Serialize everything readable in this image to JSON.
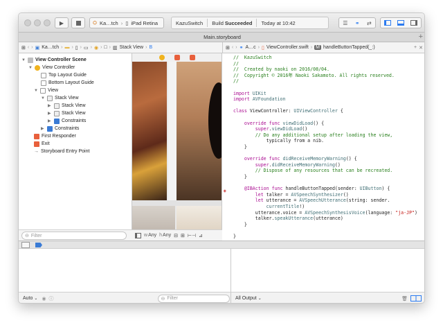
{
  "toolbar": {
    "scheme_app": "Ka…tch",
    "scheme_device": "iPad Retina",
    "status_app": "KazuSwitch",
    "status_build_prefix": "Build",
    "status_build_result": "Succeeded",
    "status_time": "Today at 10:42"
  },
  "tab": {
    "title": "Main.storyboard"
  },
  "navigator": {
    "jumpbar_project": "Ka…tch",
    "jumpbar_item": "Stack View",
    "items": [
      {
        "label": "View Controller Scene",
        "bold": true
      },
      {
        "label": "View Controller"
      },
      {
        "label": "Top Layout Guide"
      },
      {
        "label": "Bottom Layout Guide"
      },
      {
        "label": "View"
      },
      {
        "label": "Stack View"
      },
      {
        "label": "Stack View"
      },
      {
        "label": "Stack View"
      },
      {
        "label": "Constraints"
      },
      {
        "label": "Constraints"
      },
      {
        "label": "First Responder"
      },
      {
        "label": "Exit"
      },
      {
        "label": "Storyboard Entry Point"
      }
    ],
    "filter_placeholder": "Filter"
  },
  "canvas": {
    "size_w_label": "w",
    "size_w_value": "Any",
    "size_h_label": "h",
    "size_h_value": "Any"
  },
  "editor": {
    "jumpbar_auto": "A…c",
    "jumpbar_file": "ViewController.swift",
    "jumpbar_symbol_badge": "M",
    "jumpbar_symbol": "handleButtonTapped(_:)",
    "code": [
      "//  KazuSwitch",
      "//",
      "//  Created by naoki on 2016/08/04.",
      "//  Copyright © 2016年 Naoki Sakamoto. All rights reserved.",
      "//",
      "",
      "import UIKit",
      "import AVFoundation",
      "",
      "class ViewController: UIViewController {",
      "",
      "    override func viewDidLoad() {",
      "        super.viewDidLoad()",
      "        // Do any additional setup after loading the view,",
      "            typically from a nib.",
      "    }",
      "",
      "    override func didReceiveMemoryWarning() {",
      "        super.didReceiveMemoryWarning()",
      "        // Dispose of any resources that can be recreated.",
      "    }",
      "",
      "    @IBAction func handleButtonTapped(sender: UIButton) {",
      "        let talker = AVSpeechSynthesizer()",
      "        let utterance = AVSpeechUtterance(string: sender.",
      "            currentTitle!)",
      "        utterance.voice = AVSpeechSynthesisVoice(language: \"ja-JP\")",
      "        talker.speakUtterance(utterance)",
      "    }",
      "",
      "}"
    ]
  },
  "debug": {
    "auto_label": "Auto",
    "filter_placeholder": "Filter",
    "output_label": "All Output"
  }
}
